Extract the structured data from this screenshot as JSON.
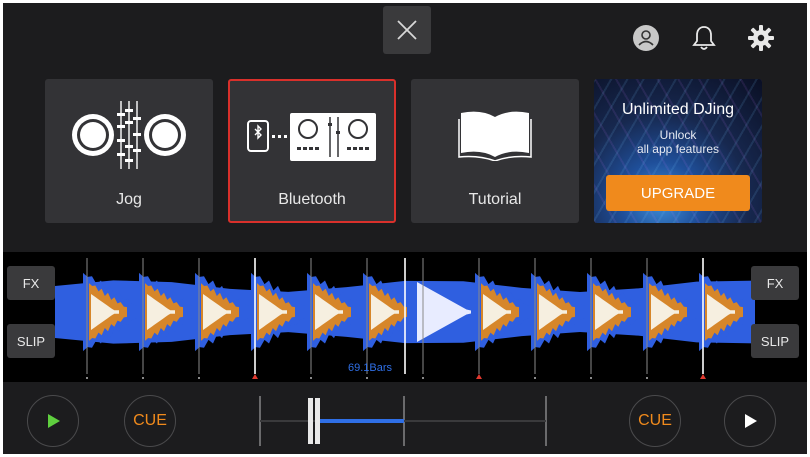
{
  "top_bar": {
    "close_icon": "x-close-icon",
    "account_icon": "account-circle-icon",
    "notification_icon": "bell-icon",
    "settings_icon": "gear-icon"
  },
  "tiles": [
    {
      "label": "Jog",
      "icon": "jog-wheels-icon"
    },
    {
      "label": "Bluetooth",
      "icon": "bluetooth-controller-icon",
      "selected": true
    },
    {
      "label": "Tutorial",
      "icon": "open-book-icon"
    }
  ],
  "promo": {
    "title": "Unlimited DJing",
    "subtitle_line1": "Unlock",
    "subtitle_line2": "all app features",
    "button_label": "UPGRADE"
  },
  "deck": {
    "fx_label": "FX",
    "slip_label": "SLIP",
    "bars_label": "69.1Bars"
  },
  "transport": {
    "cue_label": "CUE",
    "play_icon": "play-icon"
  },
  "colors": {
    "background": "#1c1c1e",
    "tile": "#333336",
    "selected_border": "#d9302b",
    "accent_orange": "#f08a1c",
    "wave_blue": "#2f5fe0",
    "wave_orange": "#d6862a",
    "play_green": "#5fcf3f"
  }
}
